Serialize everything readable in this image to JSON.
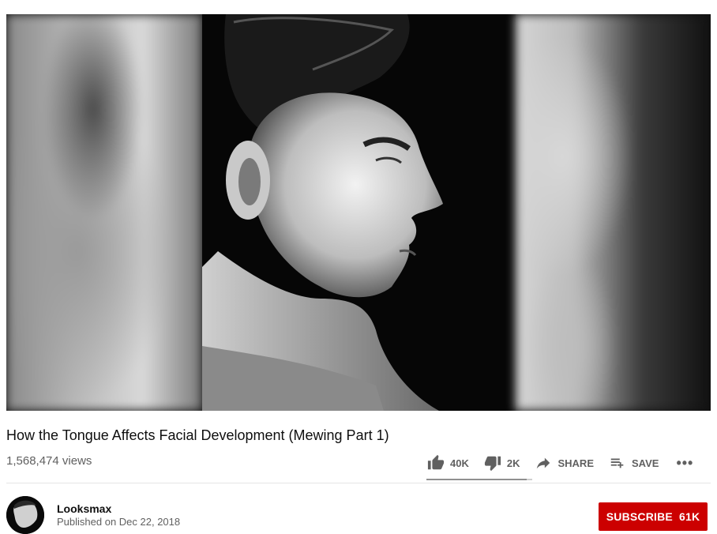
{
  "video": {
    "title": "How the Tongue Affects Facial Development (Mewing Part 1)",
    "views": "1,568,474 views"
  },
  "actions": {
    "likes": "40K",
    "dislikes": "2K",
    "share_label": "SHARE",
    "save_label": "SAVE",
    "more_label": "•••",
    "like_ratio": 0.95
  },
  "channel": {
    "name": "Looksmax",
    "published": "Published on Dec 22, 2018",
    "subscribe_label": "SUBSCRIBE",
    "subscriber_count": "61K"
  },
  "colors": {
    "subscribe_bg": "#cc0000",
    "text_primary": "#0f0f0f",
    "text_secondary": "#606060"
  },
  "icons": [
    "thumbs-up-icon",
    "thumbs-down-icon",
    "share-icon",
    "playlist-add-icon",
    "more-icon"
  ]
}
